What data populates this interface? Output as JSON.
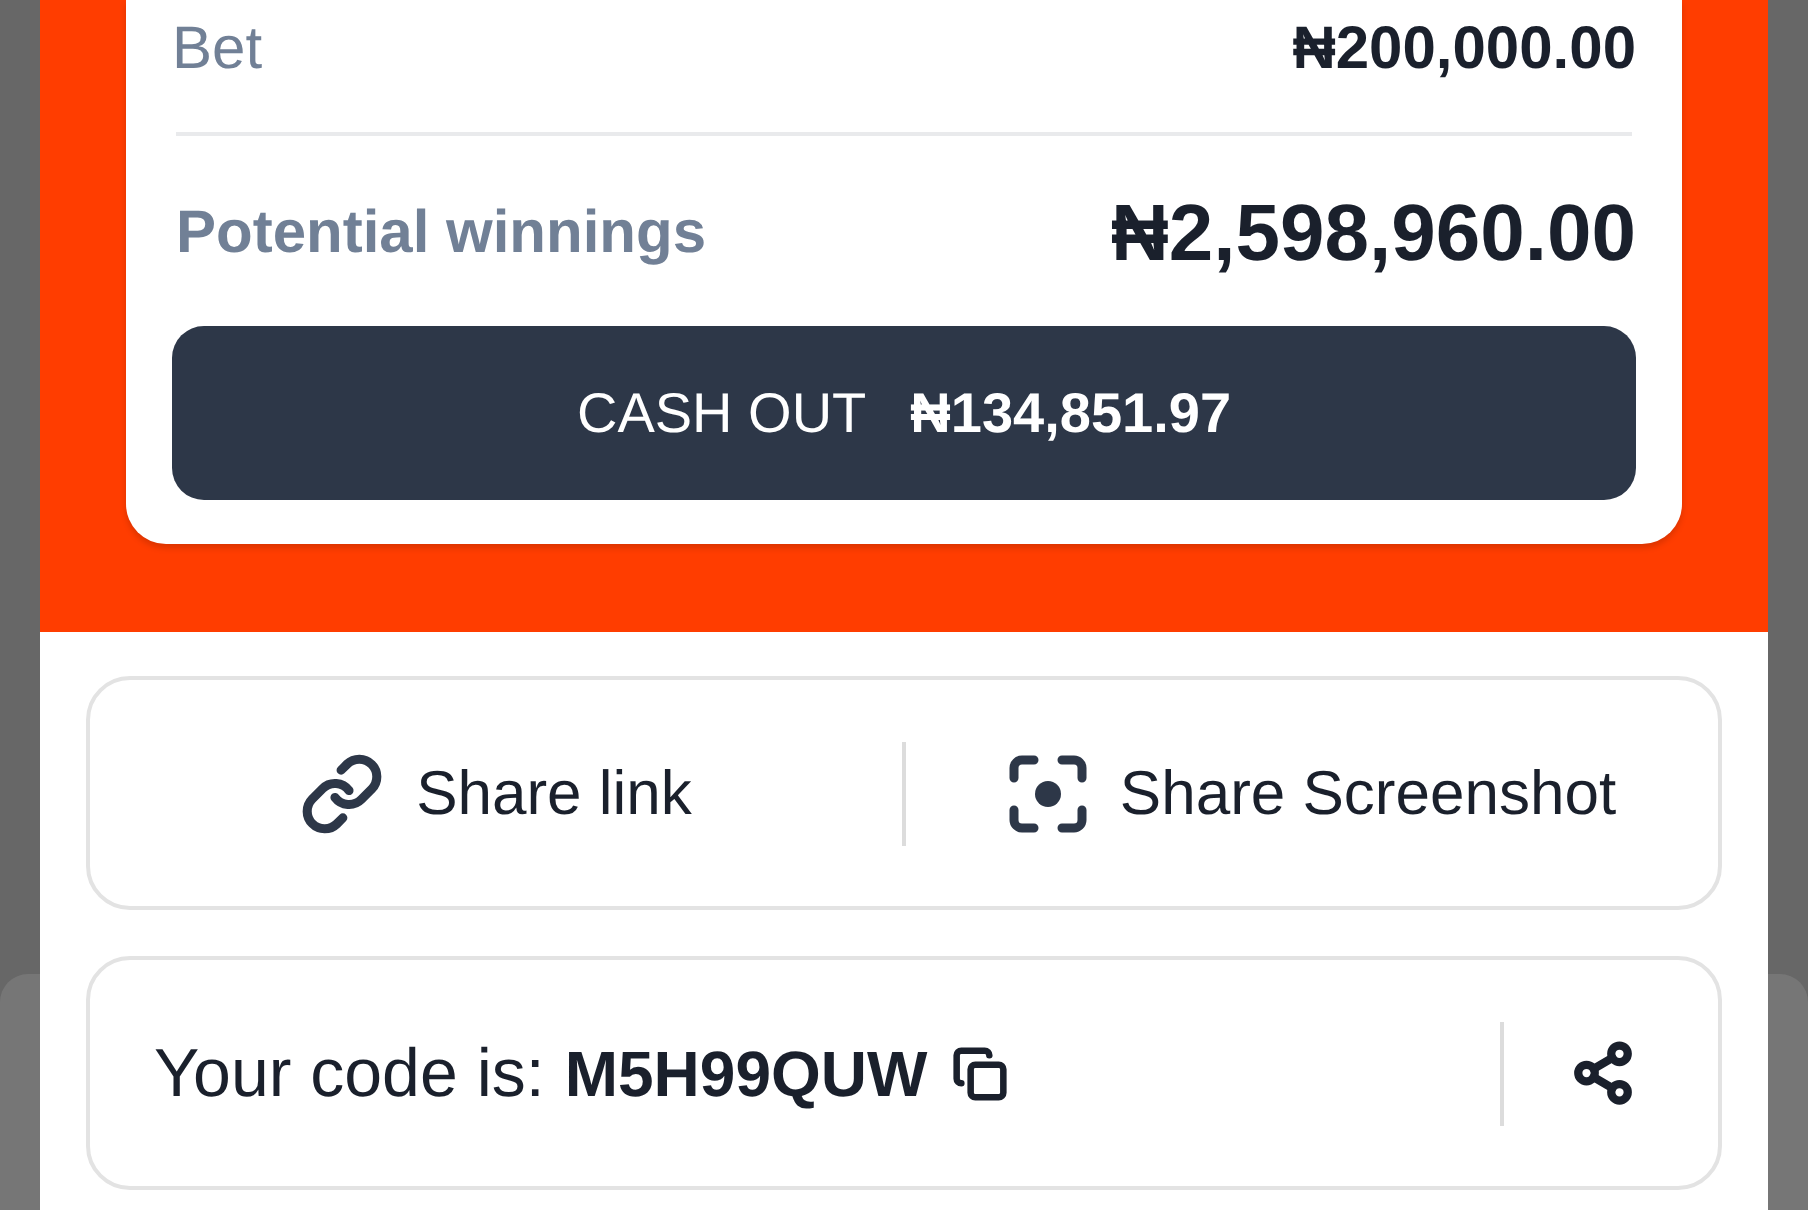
{
  "bet_summary": {
    "bet_label": "Bet",
    "bet_amount": "₦200,000.00",
    "winnings_label": "Potential winnings",
    "winnings_amount": "₦2,598,960.00",
    "cash_out": {
      "label": "CASH OUT",
      "amount": "₦134,851.97"
    }
  },
  "share_options": [
    {
      "kind": "link",
      "label": "Share link"
    },
    {
      "kind": "screenshot",
      "label": "Share Screenshot"
    }
  ],
  "code_box": {
    "prefix": "Your code is:",
    "code": "M5H99QUW"
  }
}
